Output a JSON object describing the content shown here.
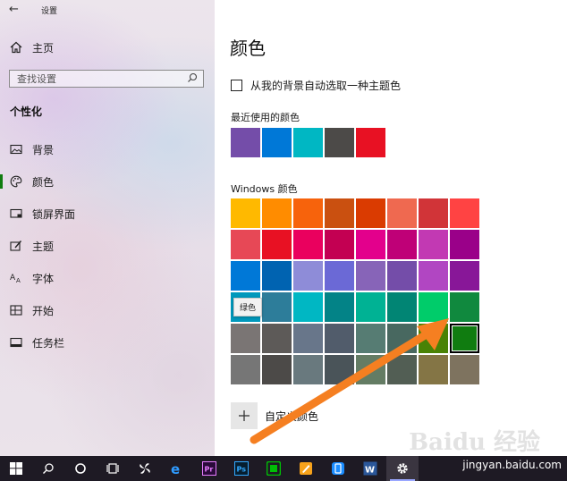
{
  "window": {
    "title": "设置",
    "back_icon": "back-arrow-icon"
  },
  "sidebar": {
    "home_label": "主页",
    "search_placeholder": "查找设置",
    "section_heading": "个性化",
    "items": [
      {
        "label": "背景",
        "icon": "picture-icon"
      },
      {
        "label": "颜色",
        "icon": "palette-icon",
        "active": true
      },
      {
        "label": "锁屏界面",
        "icon": "lock-screen-icon"
      },
      {
        "label": "主题",
        "icon": "brush-icon"
      },
      {
        "label": "字体",
        "icon": "font-icon"
      },
      {
        "label": "开始",
        "icon": "start-grid-icon"
      },
      {
        "label": "任务栏",
        "icon": "taskbar-icon"
      }
    ],
    "accent_color": "#107c10"
  },
  "main": {
    "title": "颜色",
    "auto_pick_label": "从我的背景自动选取一种主题色",
    "auto_pick_checked": false,
    "recent_heading": "最近使用的颜色",
    "recent_colors": [
      "#744da9",
      "#0078d7",
      "#00b7c3",
      "#4c4a48",
      "#e81123"
    ],
    "windows_heading": "Windows 颜色",
    "windows_colors": [
      [
        "#ffb900",
        "#ff8c00",
        "#f7630c",
        "#ca5010",
        "#da3b01",
        "#ef6950",
        "#d13438",
        "#ff4343"
      ],
      [
        "#e74856",
        "#e81123",
        "#ea005e",
        "#c30052",
        "#e3008c",
        "#bf0077",
        "#c239b3",
        "#9a0089"
      ],
      [
        "#0078d7",
        "#0063b1",
        "#8e8cd8",
        "#6b69d6",
        "#8764b8",
        "#744da9",
        "#b146c2",
        "#881798"
      ],
      [
        "#0099bc",
        "#2d7d9a",
        "#00b7c3",
        "#038387",
        "#00b294",
        "#018574",
        "#00cc6a",
        "#10893e"
      ],
      [
        "#7a7574",
        "#5d5a58",
        "#68768a",
        "#515c6b",
        "#567c73",
        "#486860",
        "#498205",
        "#107c10"
      ],
      [
        "#767676",
        "#4c4a48",
        "#69797e",
        "#4a5459",
        "#647c64",
        "#525e54",
        "#847545",
        "#7e735f"
      ]
    ],
    "selected_color": {
      "row": 4,
      "col": 7
    },
    "tooltip": "绿色",
    "custom_label": "自定义颜色"
  },
  "annotation": {
    "arrow_color": "#f57f21"
  },
  "watermark": {
    "logo": "Baidu 经验",
    "url": "jingyan.baidu.com"
  },
  "taskbar": {
    "items": [
      {
        "icon": "windows-start-icon"
      },
      {
        "icon": "search-icon"
      },
      {
        "icon": "cortana-circle-icon"
      },
      {
        "icon": "task-view-icon"
      },
      {
        "icon": "pinwheel-app-icon"
      },
      {
        "icon": "edge-browser-icon"
      },
      {
        "icon": "premiere-app-icon",
        "text": "Pr"
      },
      {
        "icon": "photoshop-app-icon",
        "text": "Ps"
      },
      {
        "icon": "iqiyi-app-icon"
      },
      {
        "icon": "paint-app-icon"
      },
      {
        "icon": "phone-app-icon"
      },
      {
        "icon": "word-app-icon",
        "text": "W"
      },
      {
        "icon": "settings-gear-icon",
        "active": true
      }
    ]
  }
}
